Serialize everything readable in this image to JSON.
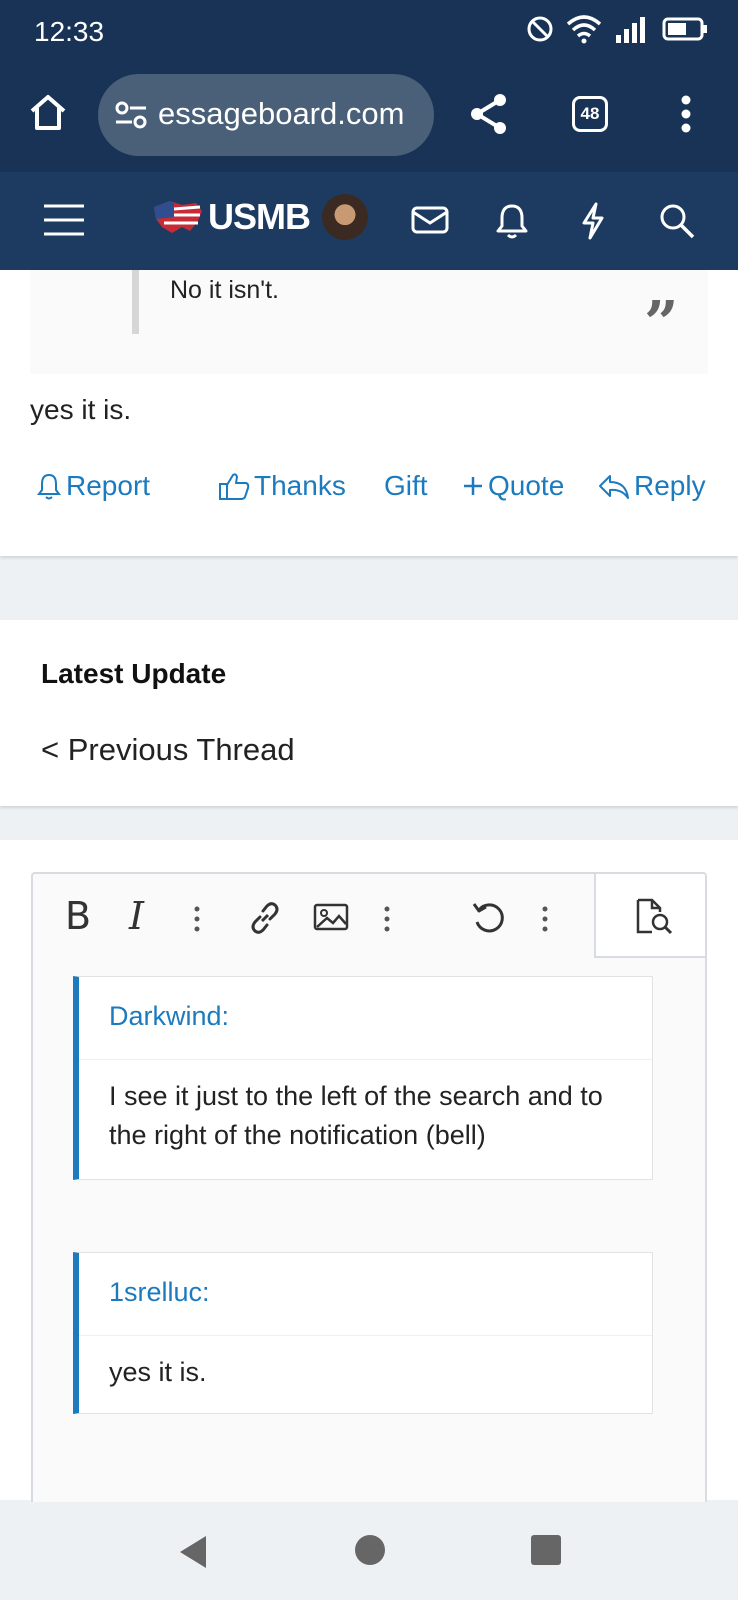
{
  "status_bar": {
    "time": "12:33",
    "icons": [
      "do-not-disturb-icon",
      "wifi-icon",
      "signal-icon",
      "battery-icon"
    ]
  },
  "browser": {
    "url": "essageboard.com",
    "tab_count": "48",
    "icons": [
      "home-icon",
      "site-settings-icon",
      "share-icon",
      "tabs-icon",
      "more-vert-icon"
    ]
  },
  "site_header": {
    "logo_text": "USMB",
    "icons": [
      "menu-icon",
      "flag-logo-icon",
      "avatar",
      "inbox-icon",
      "bell-icon",
      "lightning-icon",
      "search-icon"
    ],
    "bg_color": "#1d3b60"
  },
  "post": {
    "quoted_text": "No it isn't.",
    "body": "yes it is.",
    "actions": {
      "report": "Report",
      "thanks": "Thanks",
      "gift": "Gift",
      "quote": "Quote",
      "reply": "Reply"
    },
    "link_color": "#1c7bbf"
  },
  "latest": {
    "heading": "Latest Update",
    "previous": "< Previous Thread"
  },
  "editor": {
    "toolbar": {
      "bold": "B",
      "italic": "I",
      "icons": [
        "bold-icon",
        "italic-icon",
        "more-text-options-icon",
        "link-icon",
        "image-icon",
        "more-insert-options-icon",
        "undo-icon",
        "more-options-icon",
        "preview-icon"
      ]
    },
    "quotes": [
      {
        "author": "Darkwind:",
        "text": "I see it just to the left of the search and to the right of the notification (bell)"
      },
      {
        "author": "1srelluc:",
        "text": "yes it is."
      }
    ]
  },
  "nav_bar": {
    "icons": [
      "back-icon",
      "home-circle-icon",
      "recents-icon"
    ]
  }
}
